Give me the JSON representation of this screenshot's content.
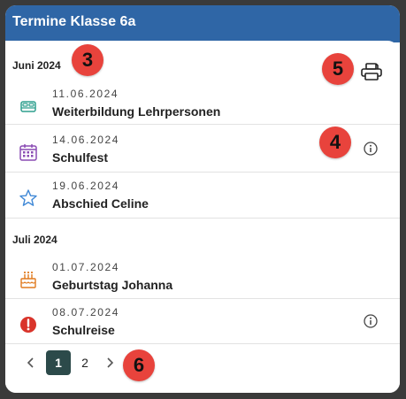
{
  "header": {
    "title": "Termine Klasse 6a"
  },
  "months": [
    {
      "label": "Juni 2024",
      "events": [
        {
          "date": "11.06.2024",
          "name": "Weiterbildung Lehrpersonen",
          "icon": "bed-icon"
        },
        {
          "date": "14.06.2024",
          "name": "Schulfest",
          "icon": "calendar-icon",
          "info": true
        },
        {
          "date": "19.06.2024",
          "name": "Abschied Celine",
          "icon": "star-icon"
        }
      ]
    },
    {
      "label": "Juli 2024",
      "events": [
        {
          "date": "01.07.2024",
          "name": "Geburtstag Johanna",
          "icon": "cake-icon"
        },
        {
          "date": "08.07.2024",
          "name": "Schulreise",
          "icon": "alert-icon",
          "info": true
        }
      ]
    }
  ],
  "pagination": {
    "pages": [
      "1",
      "2"
    ],
    "current": "1"
  },
  "badges": {
    "month_marker": "3",
    "info_marker": "4",
    "print_marker": "5",
    "pagination_marker": "6"
  },
  "colors": {
    "header": "#2f66a6",
    "bed": "#2e9f8e",
    "calendar": "#8a4bb3",
    "star": "#3f88d6",
    "cake": "#e07a1f",
    "alert": "#d9342b",
    "badge": "#e8433c",
    "page_active": "#2c4a4a"
  }
}
